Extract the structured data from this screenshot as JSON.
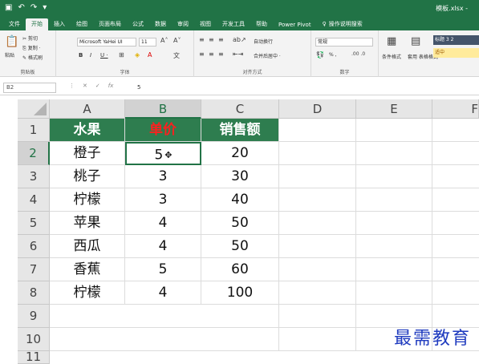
{
  "titlebar": {
    "filename": "模板.xlsx -",
    "qat_icons": [
      "save-icon",
      "undo-icon",
      "redo-icon",
      "customize-icon"
    ]
  },
  "tabs": [
    "文件",
    "开始",
    "插入",
    "绘图",
    "页面布局",
    "公式",
    "数据",
    "审阅",
    "视图",
    "开发工具",
    "帮助",
    "Power Pivot"
  ],
  "tell_me": "操作说明搜索",
  "ribbon": {
    "clipboard": {
      "cut": "剪切",
      "copy": "复制 ·",
      "paste": "粘贴",
      "format_painter": "格式刷",
      "name": "剪贴板"
    },
    "font": {
      "family": "Microsoft YaHei UI",
      "size": "11",
      "bold": "B",
      "italic": "I",
      "underline": "U ·",
      "name": "字体"
    },
    "alignment": {
      "wrap": "自动换行",
      "merge": "合并后居中 ·",
      "name": "对齐方式"
    },
    "number": {
      "format": "常规",
      "percent": "% ,",
      "name": "数字"
    },
    "styles": {
      "conditional": "条件格式",
      "table": "套用\n表格格式",
      "style1": "标题 3 2",
      "style2": "适中"
    }
  },
  "formula_bar": {
    "name_box": "B2",
    "value": "5"
  },
  "columns": [
    "A",
    "B",
    "C",
    "D",
    "E",
    "F"
  ],
  "rows": [
    "1",
    "2",
    "3",
    "4",
    "5",
    "6",
    "7",
    "8",
    "9",
    "10",
    "11"
  ],
  "table": {
    "headers": [
      "水果",
      "单价",
      "销售额"
    ],
    "data": [
      [
        "橙子",
        "5",
        "20"
      ],
      [
        "桃子",
        "3",
        "30"
      ],
      [
        "柠檬",
        "3",
        "40"
      ],
      [
        "苹果",
        "4",
        "50"
      ],
      [
        "西瓜",
        "4",
        "50"
      ],
      [
        "香蕉",
        "5",
        "60"
      ],
      [
        "柠檬",
        "4",
        "100"
      ]
    ]
  },
  "watermark": "最需教育",
  "colors": {
    "excel_green": "#217346",
    "header_fill": "#2e7d4f",
    "header_red_text": "#ff1f1f"
  }
}
